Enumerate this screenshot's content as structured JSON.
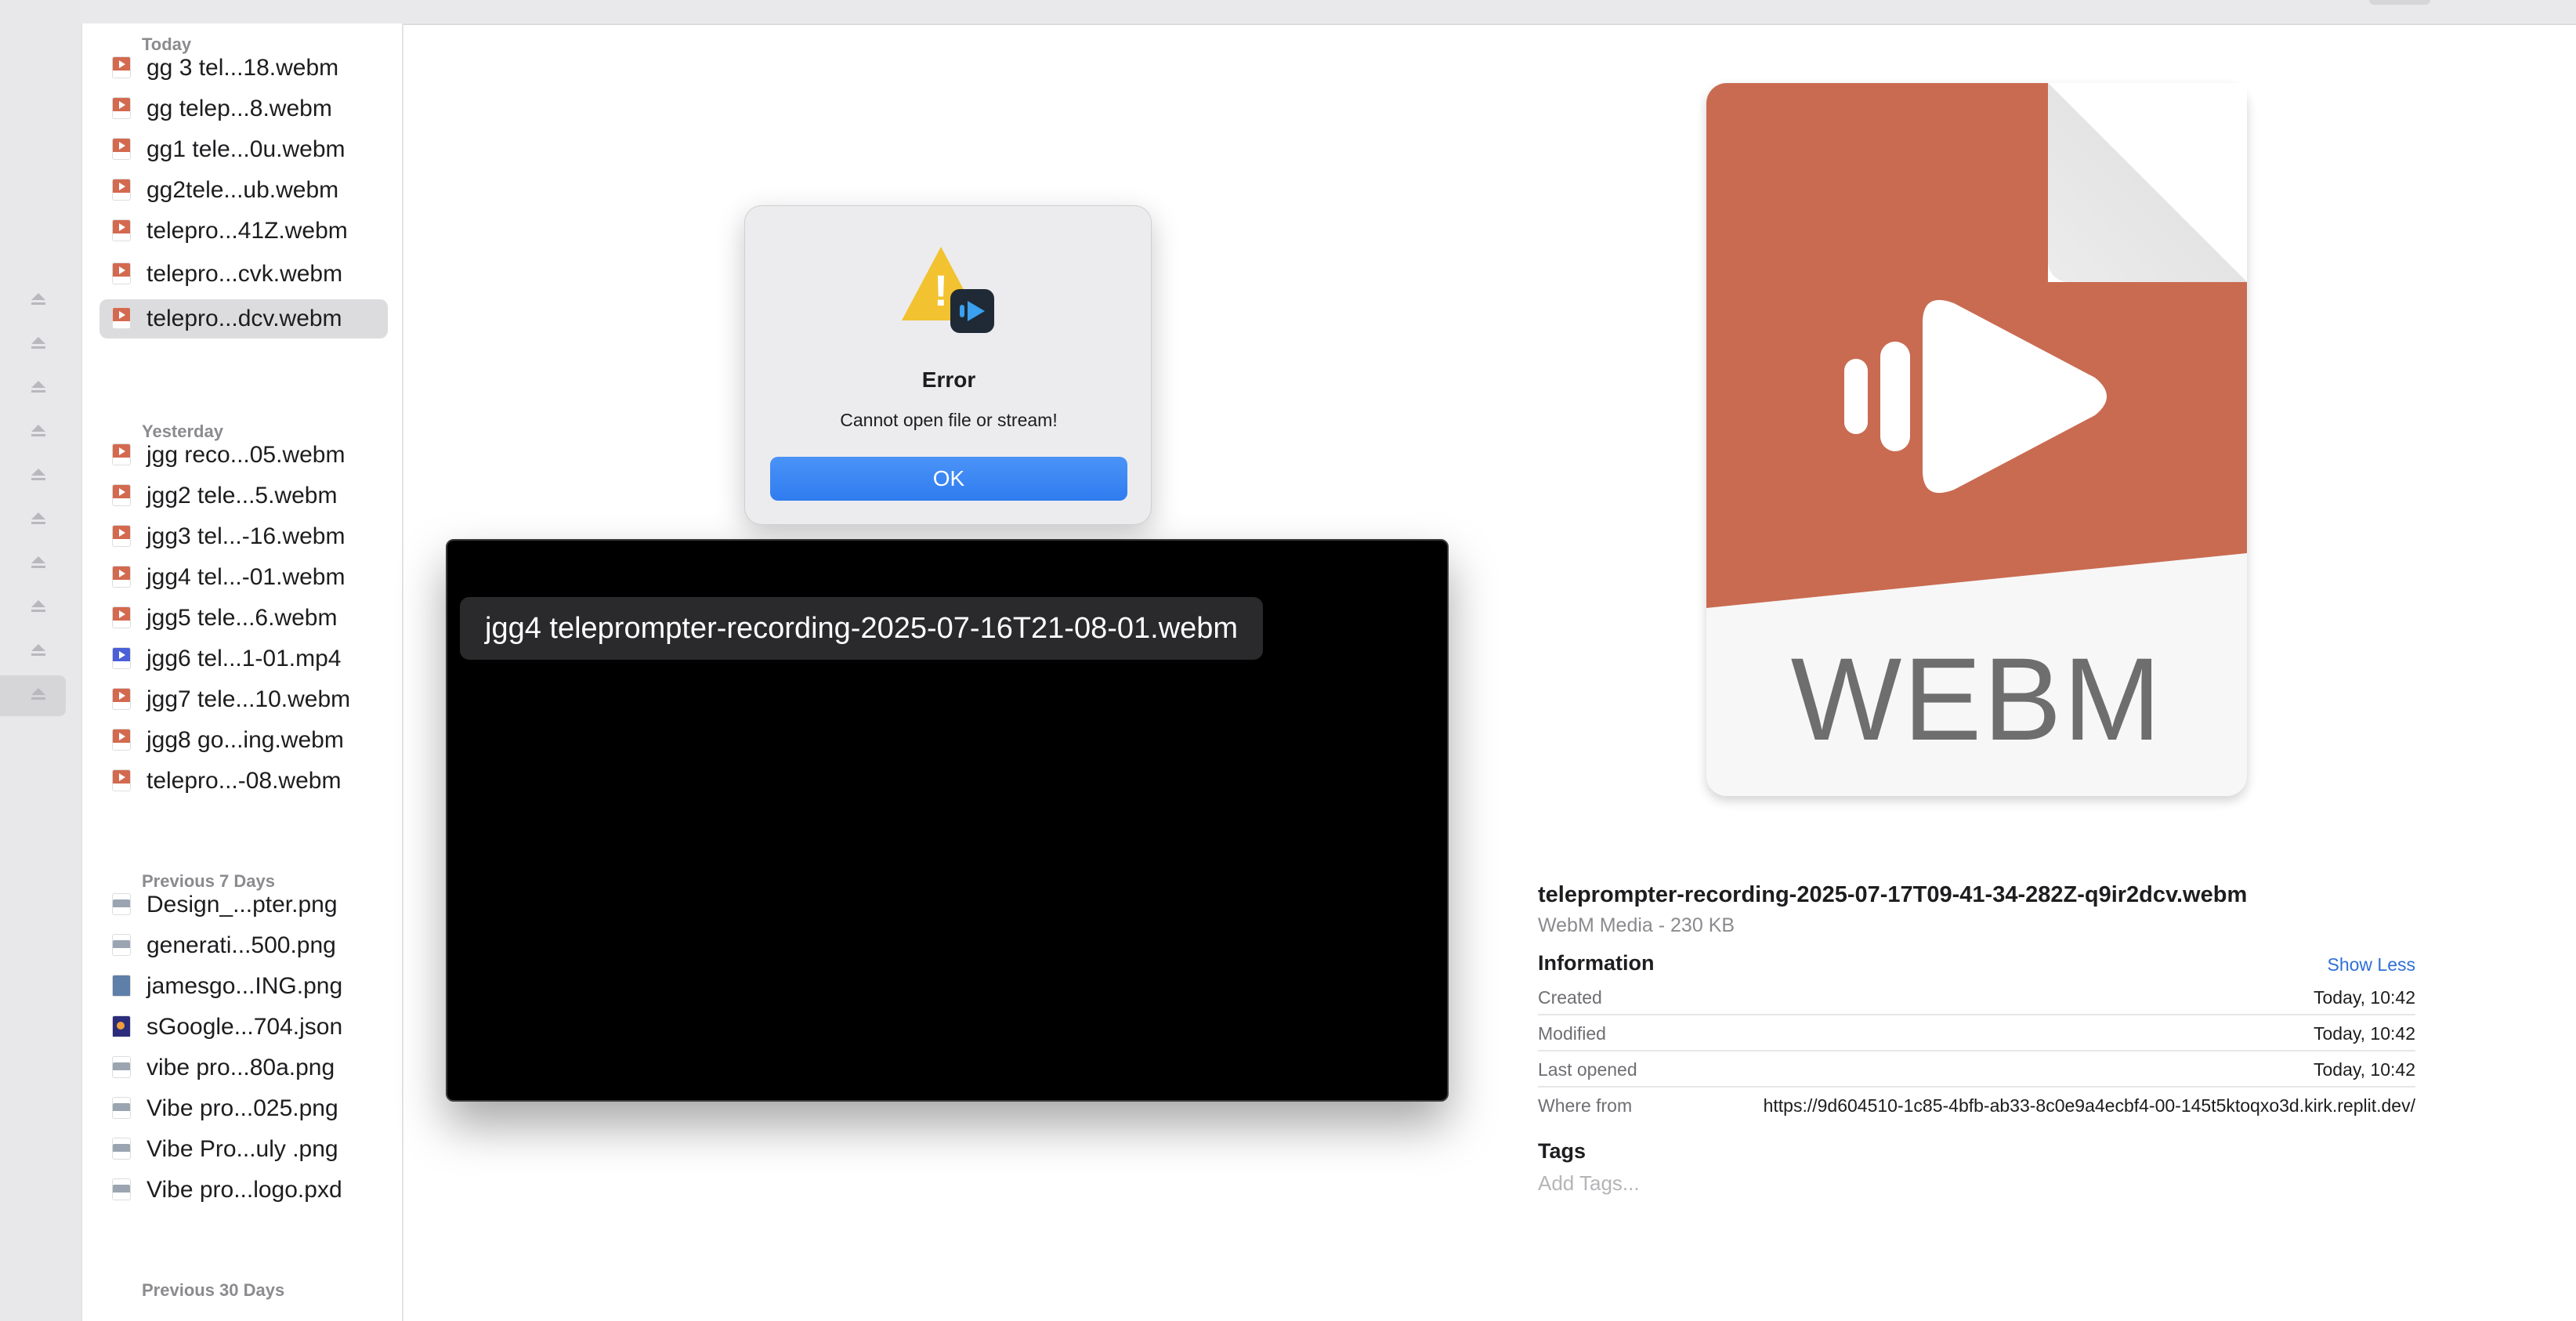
{
  "sidebar": {
    "eject_count": 10
  },
  "filelist": {
    "sections": [
      {
        "label": "Today",
        "items": [
          {
            "name": "gg 3 tel...18.webm",
            "kind": "webm"
          },
          {
            "name": "gg telep...8.webm",
            "kind": "webm"
          },
          {
            "name": "gg1 tele...0u.webm",
            "kind": "webm"
          },
          {
            "name": "gg2tele...ub.webm",
            "kind": "webm"
          },
          {
            "name": "telepro...41Z.webm",
            "kind": "webm"
          },
          {
            "name": "telepro...cvk.webm",
            "kind": "webm"
          },
          {
            "name": "telepro...dcv.webm",
            "kind": "webm",
            "selected": true
          }
        ]
      },
      {
        "label": "Yesterday",
        "items": [
          {
            "name": "jgg reco...05.webm",
            "kind": "webm"
          },
          {
            "name": "jgg2 tele...5.webm",
            "kind": "webm"
          },
          {
            "name": "jgg3 tel...-16.webm",
            "kind": "webm"
          },
          {
            "name": "jgg4 tel...-01.webm",
            "kind": "webm"
          },
          {
            "name": "jgg5 tele...6.webm",
            "kind": "webm"
          },
          {
            "name": "jgg6 tel...1-01.mp4",
            "kind": "mp4"
          },
          {
            "name": "jgg7 tele...10.webm",
            "kind": "webm"
          },
          {
            "name": "jgg8 go...ing.webm",
            "kind": "webm"
          },
          {
            "name": "telepro...-08.webm",
            "kind": "webm"
          }
        ]
      },
      {
        "label": "Previous 7 Days",
        "items": [
          {
            "name": "Design_...pter.png",
            "kind": "png"
          },
          {
            "name": "generati...500.png",
            "kind": "png"
          },
          {
            "name": "jamesgo...ING.png",
            "kind": "png2"
          },
          {
            "name": "sGoogle...704.json",
            "kind": "json"
          },
          {
            "name": "vibe pro...80a.png",
            "kind": "png"
          },
          {
            "name": "Vibe pro...025.png",
            "kind": "png"
          },
          {
            "name": "Vibe Pro...uly .png",
            "kind": "png"
          },
          {
            "name": "Vibe pro...logo.pxd",
            "kind": "png"
          }
        ]
      },
      {
        "label": "Previous 30 Days",
        "items": []
      }
    ]
  },
  "preview": {
    "file_type_label": "WEBM",
    "accent_color": "#c96b51",
    "title": "teleprompter-recording-2025-07-17T09-41-34-282Z-q9ir2dcv.webm",
    "subtitle": "WebM Media - 230 KB",
    "info_heading": "Information",
    "show_less": "Show Less",
    "rows": [
      {
        "key": "Created",
        "value": "Today, 10:42"
      },
      {
        "key": "Modified",
        "value": "Today, 10:42"
      },
      {
        "key": "Last opened",
        "value": "Today, 10:42"
      },
      {
        "key": "Where from",
        "value": "https://9d604510-1c85-4bfb-ab33-8c0e9a4ecbf4-00-145t5ktoqxo3d.kirk.replit.dev/"
      }
    ],
    "tags_heading": "Tags",
    "tags_placeholder": "Add Tags..."
  },
  "player": {
    "title": "jgg4 teleprompter-recording-2025-07-16T21-08-01.webm"
  },
  "dialog": {
    "title": "Error",
    "message": "Cannot open file or stream!",
    "ok_label": "OK",
    "icon": "warning-icon"
  }
}
